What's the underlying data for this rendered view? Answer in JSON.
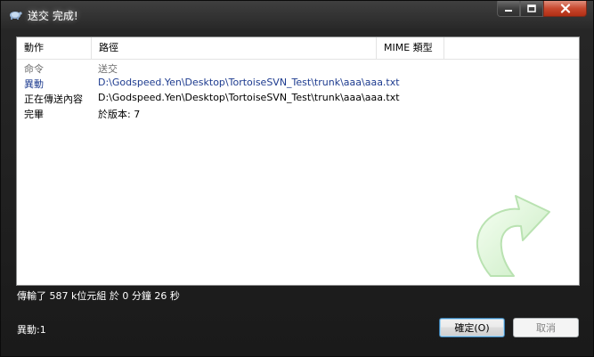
{
  "window": {
    "title": "送交 完成!"
  },
  "list": {
    "headers": [
      "動作",
      "路徑",
      "MIME 類型"
    ],
    "rows": [
      {
        "action": "命令",
        "path": "送交",
        "color": "#6d6d6d"
      },
      {
        "action": "異動",
        "path": "D:\\Godspeed.Yen\\Desktop\\TortoiseSVN_Test\\trunk\\aaa\\aaa.txt",
        "color": "#1d3b8f"
      },
      {
        "action": "正在傳送內容",
        "path": "D:\\Godspeed.Yen\\Desktop\\TortoiseSVN_Test\\trunk\\aaa\\aaa.txt",
        "color": "#000000"
      },
      {
        "action": "完畢",
        "path": "於版本: 7",
        "color": "#000000"
      }
    ]
  },
  "status": {
    "transfer": "傳輸了 587 k位元組 於 0 分鐘 26 秒",
    "changes": "異動:1"
  },
  "buttons": {
    "ok": "確定(O)",
    "cancel": "取消"
  },
  "icons": {
    "app": "tortoise-icon",
    "graphic": "curved-arrow-icon"
  }
}
